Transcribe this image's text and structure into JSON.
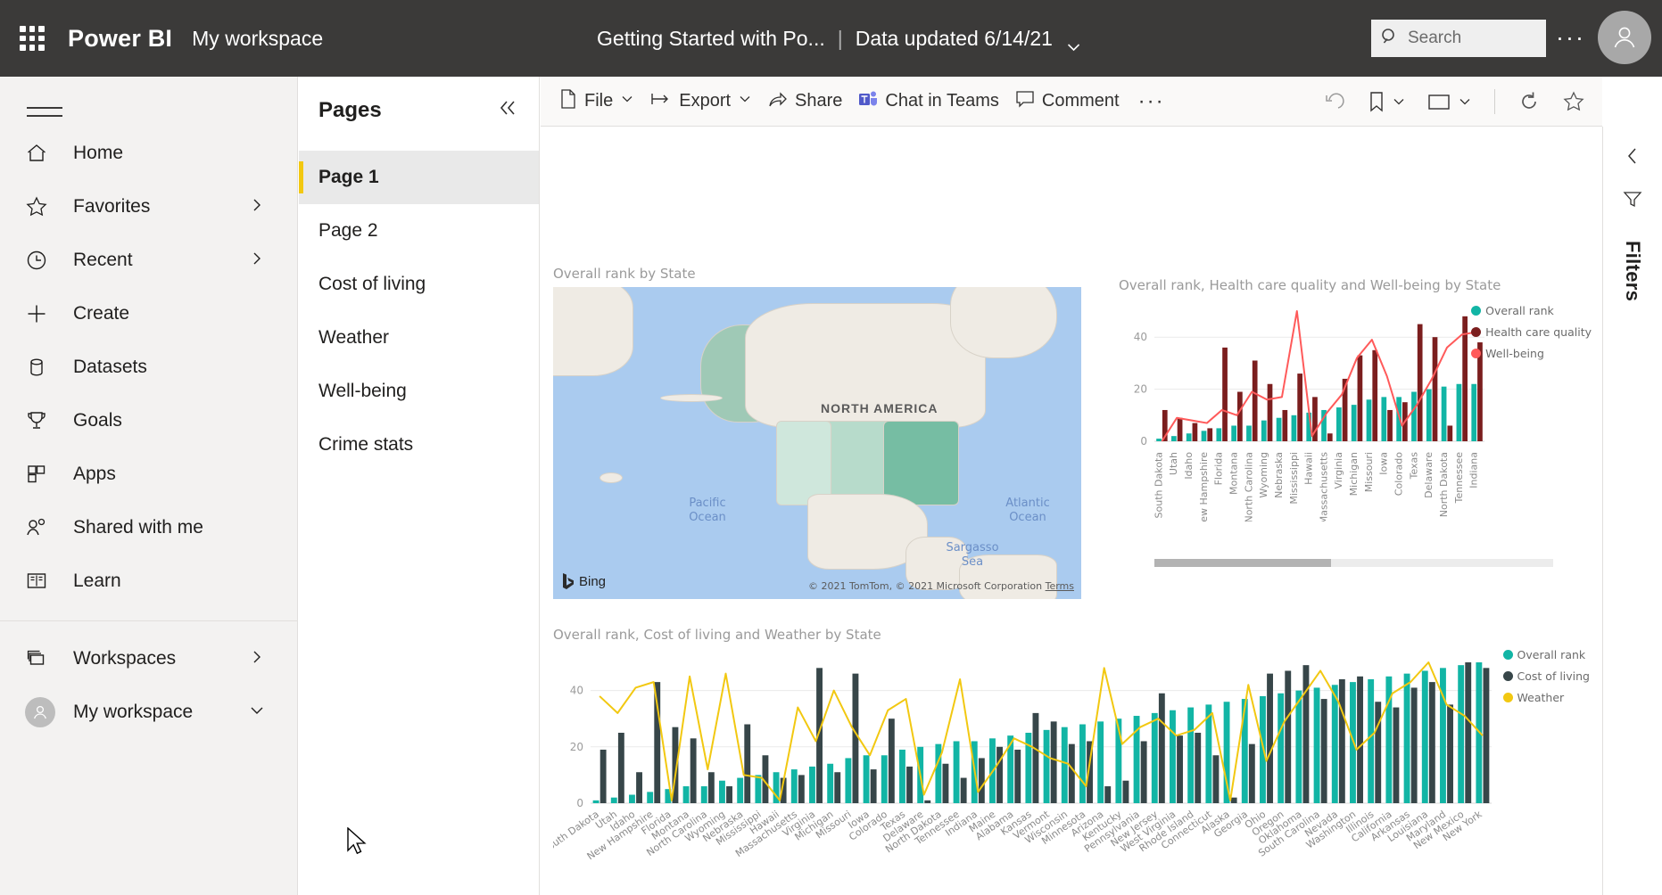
{
  "topbar": {
    "waffle_icon": "waffle-grid-icon",
    "brand": "Power BI",
    "workspace": "My workspace",
    "report_title": "Getting Started with Po...",
    "separator": "|",
    "data_updated": "Data updated 6/14/21",
    "chevron_icon": "chevron-down-icon",
    "search_placeholder": "Search",
    "search_icon": "search-icon",
    "more_icon": "ellipsis-icon",
    "avatar_icon": "user-avatar-icon"
  },
  "sidebar": {
    "hamburger_icon": "hamburger-menu-icon",
    "items": [
      {
        "label": "Home",
        "icon": "home-icon",
        "caret": false
      },
      {
        "label": "Favorites",
        "icon": "star-icon",
        "caret": true
      },
      {
        "label": "Recent",
        "icon": "clock-icon",
        "caret": true
      },
      {
        "label": "Create",
        "icon": "plus-icon",
        "caret": false
      },
      {
        "label": "Datasets",
        "icon": "database-icon",
        "caret": false
      },
      {
        "label": "Goals",
        "icon": "trophy-icon",
        "caret": false
      },
      {
        "label": "Apps",
        "icon": "apps-grid-icon",
        "caret": false
      },
      {
        "label": "Shared with me",
        "icon": "people-icon",
        "caret": false
      },
      {
        "label": "Learn",
        "icon": "book-icon",
        "caret": false
      }
    ],
    "footer_items": [
      {
        "label": "Workspaces",
        "icon": "workspaces-icon",
        "caret": "right"
      },
      {
        "label": "My workspace",
        "icon": "workspace-avatar-icon",
        "caret": "down"
      }
    ]
  },
  "pages_pane": {
    "title": "Pages",
    "collapse_icon": "double-chevron-left-icon",
    "items": [
      {
        "label": "Page 1",
        "active": true
      },
      {
        "label": "Page 2",
        "active": false
      },
      {
        "label": "Cost of living",
        "active": false
      },
      {
        "label": "Weather",
        "active": false
      },
      {
        "label": "Well-being",
        "active": false
      },
      {
        "label": "Crime stats",
        "active": false
      }
    ]
  },
  "toolbar": {
    "items": [
      {
        "label": "File",
        "icon": "file-icon",
        "caret": true
      },
      {
        "label": "Export",
        "icon": "export-icon",
        "caret": true
      },
      {
        "label": "Share",
        "icon": "share-icon",
        "caret": false
      },
      {
        "label": "Chat in Teams",
        "icon": "teams-icon",
        "caret": false
      },
      {
        "label": "Comment",
        "icon": "comment-icon",
        "caret": false
      }
    ],
    "more_label": "···",
    "more_icon": "ellipsis-icon",
    "right_icons": [
      {
        "icon": "reset-icon",
        "caret": false
      },
      {
        "icon": "bookmark-icon",
        "caret": true
      },
      {
        "icon": "view-icon",
        "caret": true
      },
      {
        "icon": "refresh-icon",
        "caret": false
      },
      {
        "icon": "favorite-star-icon",
        "caret": false
      }
    ]
  },
  "filters_pane": {
    "expand_icon": "chevron-left-icon",
    "filter_icon": "filter-funnel-icon",
    "label": "Filters"
  },
  "map_visual": {
    "title": "Overall rank by State",
    "region_label": "NORTH AMERICA",
    "ocean_labels": [
      "Pacific Ocean",
      "Atlantic Ocean",
      "Sargasso Sea"
    ],
    "provider": "Bing",
    "provider_icon": "bing-logo-icon",
    "attribution": "© 2021 TomTom, © 2021 Microsoft Corporation",
    "terms": "Terms"
  },
  "chart_data": [
    {
      "id": "chart1",
      "type": "bar",
      "title": "Overall rank, Health care quality and Well-being by State",
      "xlabel": "",
      "ylabel": "",
      "ylim": [
        0,
        50
      ],
      "yticks": [
        0,
        20,
        40
      ],
      "grid": true,
      "legend_position": "right",
      "scrollbar": true,
      "categories": [
        "South Dakota",
        "Utah",
        "Idaho",
        "New Hampshire",
        "Florida",
        "Montana",
        "North Carolina",
        "Wyoming",
        "Nebraska",
        "Mississippi",
        "Hawaii",
        "Massachusetts",
        "Virginia",
        "Michigan",
        "Missouri",
        "Iowa",
        "Colorado",
        "Texas",
        "Delaware",
        "North Dakota",
        "Tennessee",
        "Indiana"
      ],
      "series": [
        {
          "name": "Overall rank",
          "kind": "bar",
          "color": "#12B5A5",
          "values": [
            1,
            2,
            3,
            4,
            5,
            6,
            6,
            8,
            9,
            10,
            11,
            12,
            13,
            14,
            16,
            17,
            17,
            19,
            20,
            21,
            22,
            22
          ]
        },
        {
          "name": "Health care quality",
          "kind": "bar",
          "color": "#7B1E1E",
          "values": [
            12,
            9,
            7,
            5,
            36,
            19,
            31,
            22,
            12,
            26,
            17,
            3,
            24,
            33,
            35,
            12,
            15,
            45,
            40,
            6,
            48,
            38
          ]
        },
        {
          "name": "Well-being",
          "kind": "line",
          "color": "#FF5A5A",
          "values": [
            0,
            9,
            8,
            7,
            12,
            10,
            19,
            16,
            17,
            50,
            2,
            11,
            18,
            32,
            39,
            25,
            6,
            14,
            24,
            36,
            41,
            42
          ]
        }
      ]
    },
    {
      "id": "chart2",
      "type": "bar",
      "title": "Overall rank, Cost of living and Weather by State",
      "xlabel": "",
      "ylabel": "",
      "ylim": [
        0,
        50
      ],
      "yticks": [
        0,
        20,
        40
      ],
      "grid": true,
      "legend_position": "right",
      "scrollbar": false,
      "categories": [
        "South Dakota",
        "Utah",
        "Idaho",
        "New Hampshire",
        "Florida",
        "Montana",
        "North Carolina",
        "Wyoming",
        "Nebraska",
        "Mississippi",
        "Hawaii",
        "Massachusetts",
        "Virginia",
        "Michigan",
        "Missouri",
        "Iowa",
        "Colorado",
        "Texas",
        "Delaware",
        "North Dakota",
        "Tennessee",
        "Indiana",
        "Maine",
        "Alabama",
        "Kansas",
        "Vermont",
        "Wisconsin",
        "Minnesota",
        "Arizona",
        "Kentucky",
        "Pennsylvania",
        "New Jersey",
        "West Virginia",
        "Rhode Island",
        "Connecticut",
        "Alaska",
        "Georgia",
        "Ohio",
        "Oregon",
        "Oklahoma",
        "South Carolina",
        "Nevada",
        "Washington",
        "Illinois",
        "California",
        "Arkansas",
        "Louisiana",
        "Maryland",
        "New Mexico",
        "New York"
      ],
      "series": [
        {
          "name": "Overall rank",
          "kind": "bar",
          "color": "#12B5A5",
          "values": [
            1,
            2,
            3,
            4,
            5,
            6,
            6,
            8,
            9,
            10,
            11,
            12,
            13,
            14,
            16,
            17,
            17,
            19,
            20,
            21,
            22,
            22,
            23,
            24,
            25,
            26,
            27,
            28,
            29,
            30,
            31,
            32,
            33,
            34,
            35,
            36,
            37,
            38,
            39,
            40,
            41,
            42,
            43,
            44,
            45,
            46,
            47,
            48,
            49,
            50
          ]
        },
        {
          "name": "Cost of living",
          "kind": "bar",
          "color": "#374649",
          "values": [
            19,
            25,
            11,
            43,
            27,
            23,
            11,
            6,
            28,
            17,
            9,
            10,
            48,
            11,
            46,
            12,
            30,
            13,
            1,
            14,
            9,
            16,
            20,
            19,
            32,
            29,
            21,
            22,
            6,
            8,
            22,
            39,
            24,
            25,
            17,
            2,
            21,
            46,
            47,
            49,
            37,
            44,
            45,
            36,
            34,
            41,
            43,
            35,
            50,
            48
          ]
        },
        {
          "name": "Weather",
          "kind": "line",
          "color": "#F2C811",
          "values": [
            38,
            32,
            41,
            43,
            1,
            45,
            12,
            46,
            10,
            9,
            1,
            34,
            22,
            40,
            27,
            17,
            33,
            37,
            3,
            18,
            44,
            4,
            13,
            23,
            20,
            16,
            14,
            6,
            48,
            21,
            27,
            30,
            24,
            26,
            32,
            1,
            42,
            15,
            29,
            38,
            47,
            36,
            19,
            25,
            39,
            43,
            50,
            35,
            31,
            24
          ]
        }
      ]
    }
  ]
}
